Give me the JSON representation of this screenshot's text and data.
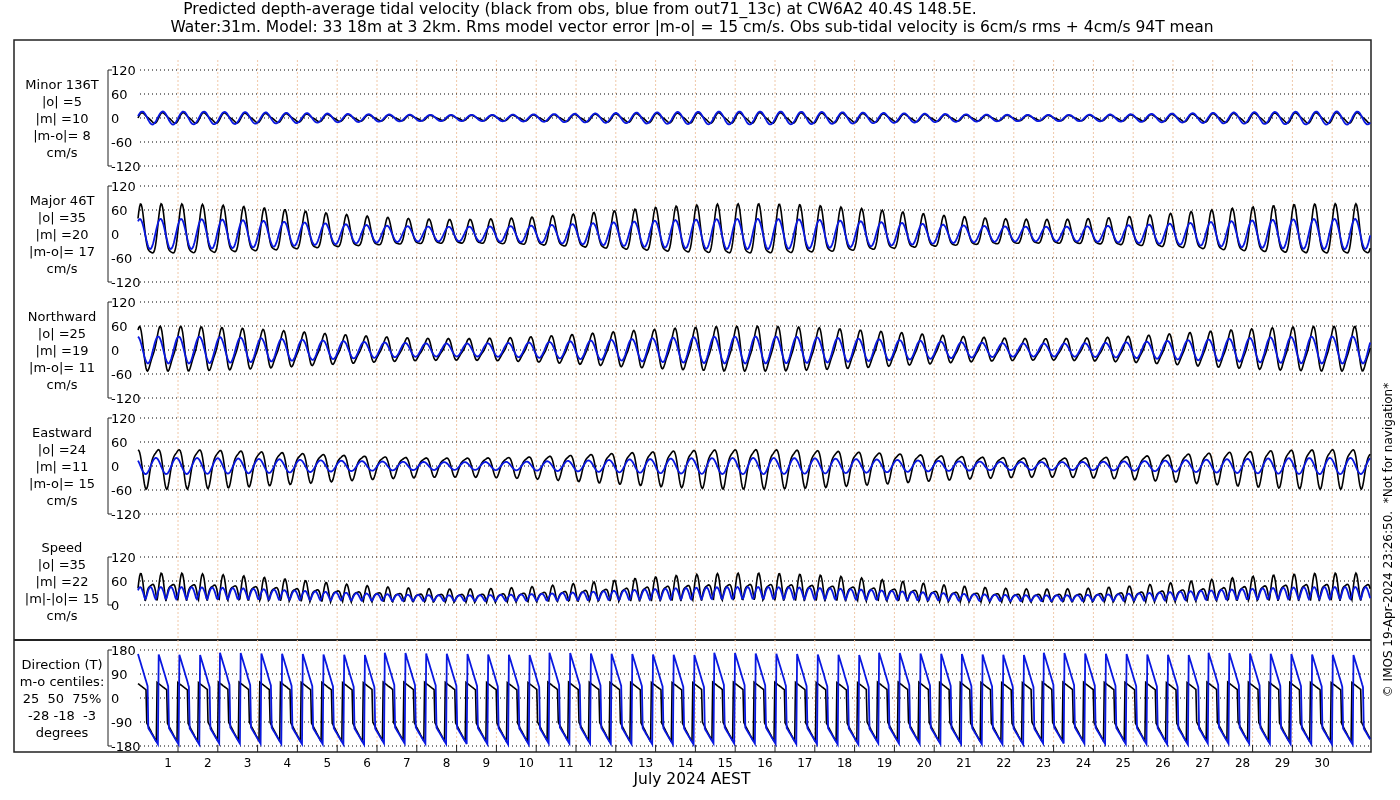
{
  "title_lines": [
    "Predicted depth-average tidal velocity (black from obs, blue from out71_13c) at CW6A2 40.4S 148.5E.",
    "Water:31m. Model: 33 18m at 3 2km. Rms model vector error |m-o| = 15 cm/s. Obs sub-tidal velocity is 6cm/s rms + 4cm/s 94T mean"
  ],
  "panels": [
    {
      "kind": "signed",
      "label_lines": [
        "Minor 136T",
        "|o| =5",
        "|m| =10",
        "|m-o|= 8",
        "cm/s"
      ],
      "yticks": [
        "120",
        "60",
        "0",
        "-60",
        "-120"
      ]
    },
    {
      "kind": "signed",
      "label_lines": [
        "Major 46T",
        "|o| =35",
        "|m| =20",
        "|m-o|= 17",
        "cm/s"
      ],
      "yticks": [
        "120",
        "60",
        "0",
        "-60",
        "-120"
      ]
    },
    {
      "kind": "signed",
      "label_lines": [
        "Northward",
        "|o| =25",
        "|m| =19",
        "|m-o|= 11",
        "cm/s"
      ],
      "yticks": [
        "120",
        "60",
        "0",
        "-60",
        "-120"
      ]
    },
    {
      "kind": "signed",
      "label_lines": [
        "Eastward",
        "|o| =24",
        "|m| =11",
        "|m-o|= 15",
        "cm/s"
      ],
      "yticks": [
        "120",
        "60",
        "0",
        "-60",
        "-120"
      ]
    },
    {
      "kind": "speed",
      "label_lines": [
        "Speed",
        "|o| =35",
        "|m| =22",
        "|m|-|o|= 15",
        "cm/s"
      ],
      "yticks": [
        "120",
        "60",
        "0"
      ]
    },
    {
      "kind": "direction",
      "label_lines": [
        "Direction (T)",
        "m-o centiles:",
        "25  50  75%",
        "-28 -18  -3",
        "degrees"
      ],
      "yticks": [
        "180",
        "90",
        "0",
        "-90",
        "-180"
      ]
    }
  ],
  "days": [
    "1",
    "2",
    "3",
    "4",
    "5",
    "6",
    "7",
    "8",
    "9",
    "10",
    "11",
    "12",
    "13",
    "14",
    "15",
    "16",
    "17",
    "18",
    "19",
    "20",
    "21",
    "22",
    "23",
    "24",
    "25",
    "26",
    "27",
    "28",
    "29",
    "30"
  ],
  "xlabel": "July 2024 AEST",
  "credit": "© IMOS 19-Apr-2024 23:26:50.  *Not for navigation*"
}
